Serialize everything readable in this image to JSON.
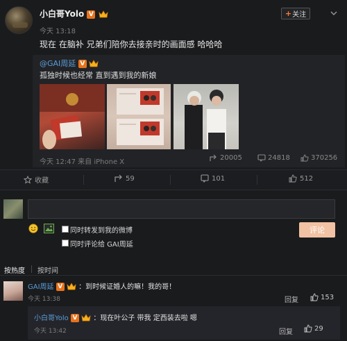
{
  "post": {
    "author": "小白哥Yolo",
    "time": "今天 13:18",
    "follow_label": "关注",
    "text": "现在 在脑补 兄弟们陪你去接亲时的画面感 哈哈哈"
  },
  "retweet": {
    "author": "@GAI周延",
    "text": "孤独时候也经常 直到遇到我的新娘",
    "meta": "今天 12:47 来自 iPhone X",
    "stats": {
      "shares": "20005",
      "comments": "24818",
      "likes": "370256"
    }
  },
  "actions": {
    "favorite_label": "收藏",
    "repost_count": "59",
    "comment_count": "101",
    "like_count": "512"
  },
  "comment_box": {
    "option_repost": "同时转发到我的微博",
    "option_comment": "同时评论给 GAI周延",
    "submit_label": "评论"
  },
  "sort": {
    "hot": "按热度",
    "time": "按时间"
  },
  "comments": [
    {
      "author": "GAI周延",
      "text": "：到时候证婚人的嘛！我的哥！",
      "time": "今天 13:38",
      "reply_label": "回复",
      "likes": "153"
    }
  ],
  "nested_reply": {
    "author": "小白哥Yolo",
    "text": "：现在叶公子 带我 定西装去啦 嗯",
    "time": "今天 13:42",
    "reply_label": "回复",
    "likes": "29"
  },
  "colors": {
    "link": "#5b9dd8",
    "accent": "#e8731c",
    "submit": "#f2c2a4",
    "background": "#1a1b1d"
  }
}
